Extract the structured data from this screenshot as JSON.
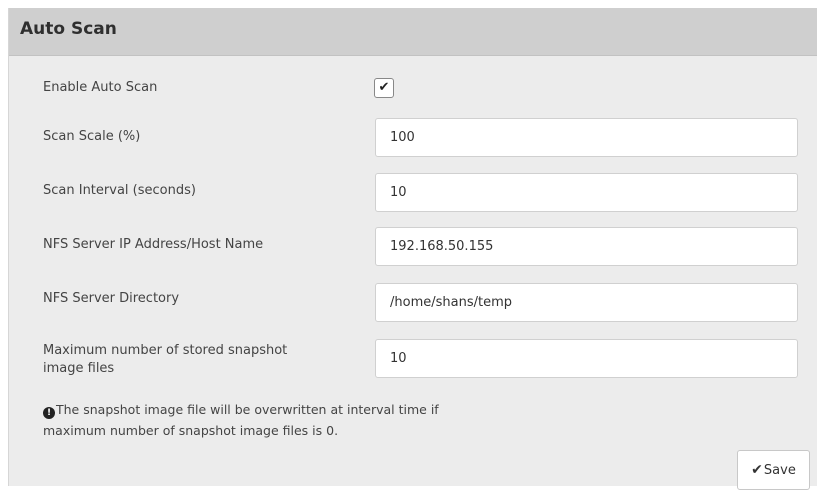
{
  "panel": {
    "title": "Auto Scan"
  },
  "form": {
    "enable_label": "Enable Auto Scan",
    "enable_checked": true,
    "scale_label": "Scan Scale (%)",
    "scale_value": "100",
    "interval_label": "Scan Interval (seconds)",
    "interval_value": "10",
    "nfs_ip_label": "NFS Server IP Address/Host Name",
    "nfs_ip_value": "192.168.50.155",
    "nfs_dir_label": "NFS Server Directory",
    "nfs_dir_value": "/home/shans/temp",
    "max_files_label_line1": "Maximum number of stored snapshot",
    "max_files_label_line2": "image files",
    "max_files_value": "10"
  },
  "note": {
    "icon": "info-icon",
    "line1": "The snapshot image file will be overwritten at interval time if",
    "line2": "maximum number of snapshot image files is 0."
  },
  "actions": {
    "save_label": "Save",
    "save_icon": "checkmark-icon"
  }
}
